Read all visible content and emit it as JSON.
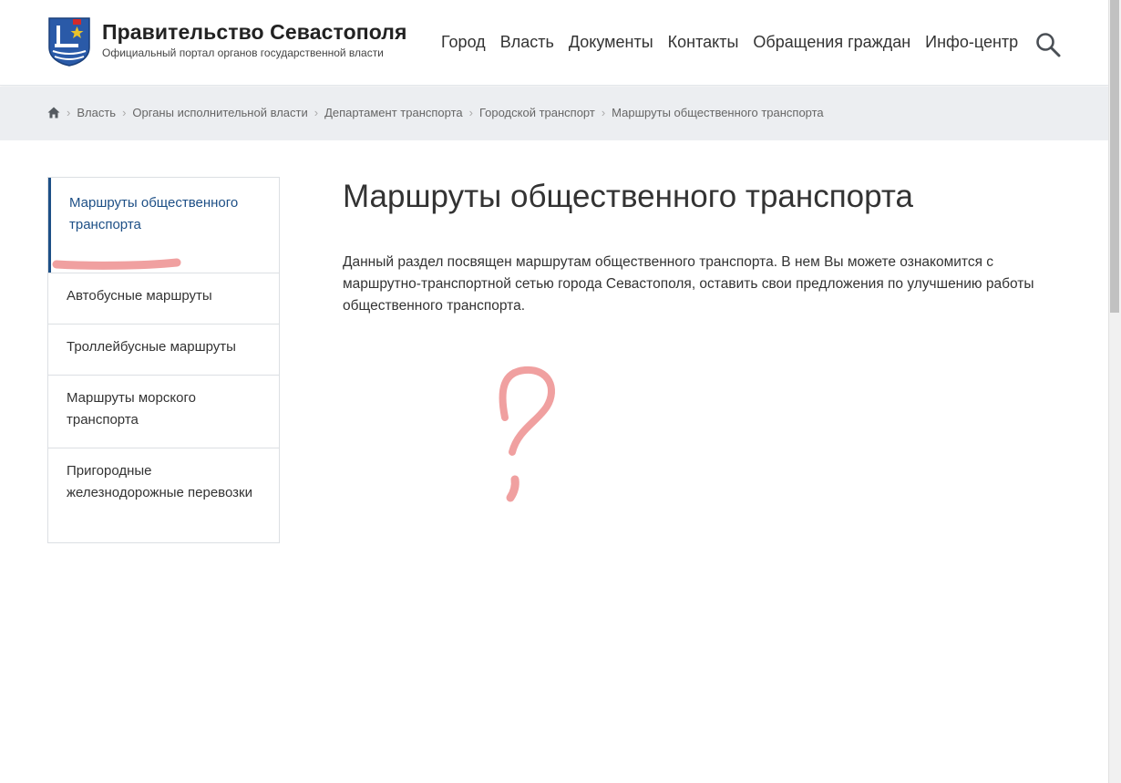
{
  "header": {
    "title": "Правительство Севастополя",
    "subtitle": "Официальный портал органов государственной власти",
    "nav": [
      "Город",
      "Власть",
      "Документы",
      "Контакты",
      "Обращения граждан",
      "Инфо-центр"
    ]
  },
  "breadcrumb": [
    "Власть",
    "Органы исполнительной власти",
    "Департамент транспорта",
    "Городской транспорт",
    "Маршруты общественного транспорта"
  ],
  "sidebar": {
    "items": [
      {
        "label": "Маршруты общественного транспорта",
        "active": true
      },
      {
        "label": "Автобусные маршруты"
      },
      {
        "label": "Троллейбусные маршруты"
      },
      {
        "label": "Маршруты морского транспорта"
      },
      {
        "label": "Пригородные железнодорожные перевозки"
      }
    ]
  },
  "main": {
    "title": "Маршруты общественного транспорта",
    "intro": "Данный раздел посвящен маршрутам общественного транспорта. В нем Вы можете ознакомится с маршрутно-транспортной сетью города Севастополя, оставить свои предложения по улучшению работы общественного транспорта."
  },
  "annotations": {
    "underline_color": "#f0a0a0",
    "question_mark_color": "#f0a0a0"
  },
  "colors": {
    "accent": "#1d4f86",
    "breadcrumb_bg": "#eceef1"
  },
  "icons": [
    "coat-of-arms-logo",
    "search-icon",
    "home-icon",
    "chevron-right-icon"
  ]
}
